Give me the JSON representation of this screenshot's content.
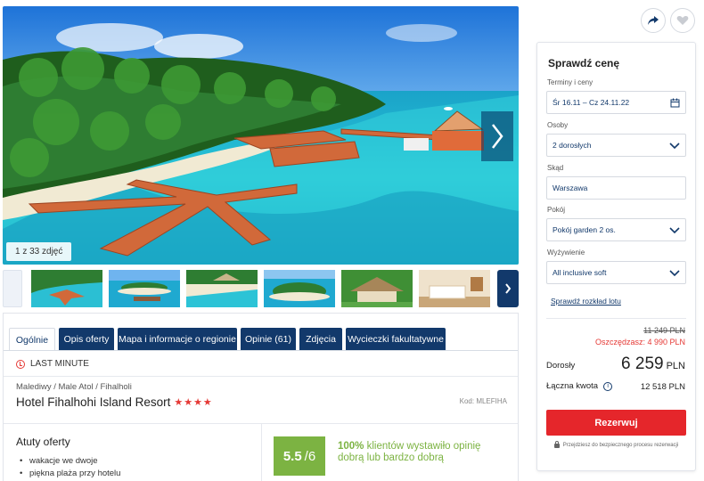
{
  "gallery": {
    "counter": "1 z 33 zdjęć",
    "thumbnails": [
      "thumb-1",
      "thumb-2",
      "thumb-3",
      "thumb-4",
      "thumb-5",
      "thumb-6"
    ]
  },
  "tabs": [
    {
      "label": "Ogólnie",
      "active": true
    },
    {
      "label": "Opis oferty"
    },
    {
      "label": "Mapa i informacje o regionie"
    },
    {
      "label": "Opinie (61)"
    },
    {
      "label": "Zdjęcia"
    },
    {
      "label": "Wycieczki fakultatywne"
    }
  ],
  "offer": {
    "badge": "LAST MINUTE",
    "location": "Malediwy / Male Atol / Fihalholi",
    "hotel_name": "Hotel Fihalhohi Island Resort",
    "stars": "★★★★",
    "code": "Kod: MLEFIHA"
  },
  "highlights": {
    "title": "Atuty oferty",
    "items": [
      "wakacje we dwoje",
      "piękna plaża przy hotelu"
    ]
  },
  "rating": {
    "score": "5.5",
    "scale": "/6",
    "percent": "100%",
    "text": " klientów wystawiło opinię dobrą lub bardzo dobrą"
  },
  "price_panel": {
    "title": "Sprawdź cenę",
    "dates_label": "Terminy i ceny",
    "dates_value": "Śr 16.11 – Cz 24.11.22",
    "persons_label": "Osoby",
    "persons_value": "2 dorosłych",
    "from_label": "Skąd",
    "from_value": "Warszawa",
    "room_label": "Pokój",
    "room_value": "Pokój garden 2 os.",
    "board_label": "Wyżywienie",
    "board_value": "All inclusive soft",
    "schedule_link": "Sprawdź rozkład lotu",
    "old_price": "11 249  PLN",
    "savings": "Oszczędzasz: 4 990 PLN",
    "adult_label": "Dorosły",
    "adult_price": "6 259",
    "currency": "PLN",
    "total_label": "Łączna kwota",
    "total_price": "12 518 PLN",
    "book_button": "Rezerwuj",
    "secure_note": "Przejdziesz do bezpiecznego procesu rezerwacji"
  },
  "colors": {
    "navy": "#12396b",
    "red": "#e5262b",
    "green": "#7cb342"
  }
}
